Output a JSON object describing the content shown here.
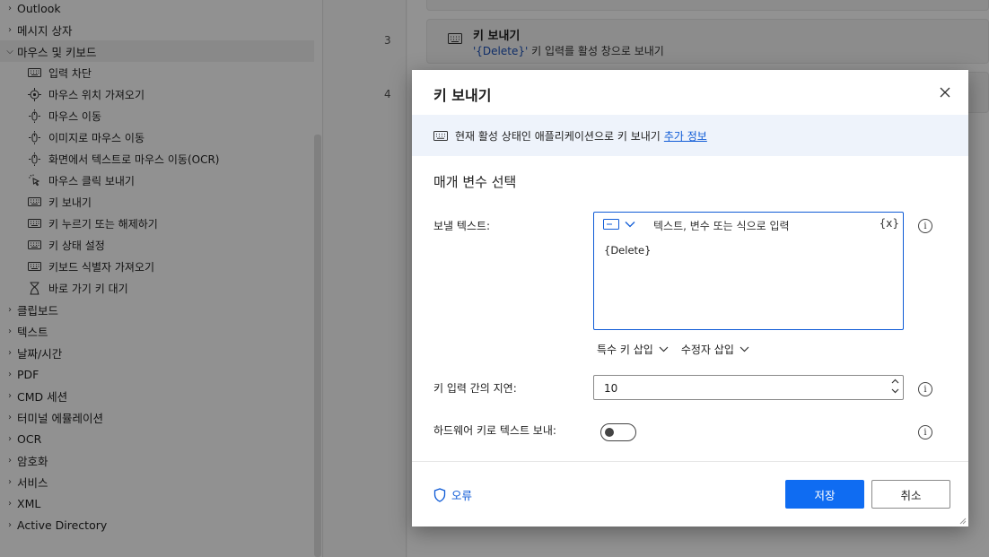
{
  "sidebar": {
    "items_before": [
      {
        "label": "Outlook",
        "expanded": false
      },
      {
        "label": "메시지 상자",
        "expanded": false
      },
      {
        "label": "마우스 및 키보드",
        "expanded": true
      }
    ],
    "sub_items": [
      {
        "label": "입력 차단",
        "icon": "keyboard-icon"
      },
      {
        "label": "마우스 위치 가져오기",
        "icon": "crosshair-icon"
      },
      {
        "label": "마우스 이동",
        "icon": "mouse-move-icon"
      },
      {
        "label": "이미지로 마우스 이동",
        "icon": "mouse-move-icon"
      },
      {
        "label": "화면에서 텍스트로 마우스 이동(OCR)",
        "icon": "mouse-move-icon"
      },
      {
        "label": "마우스 클릭 보내기",
        "icon": "mouse-click-icon"
      },
      {
        "label": "키 보내기",
        "icon": "keyboard-icon"
      },
      {
        "label": "키 누르기 또는 해제하기",
        "icon": "keyboard-icon"
      },
      {
        "label": "키 상태 설정",
        "icon": "keyboard-icon"
      },
      {
        "label": "키보드 식별자 가져오기",
        "icon": "keyboard-icon"
      },
      {
        "label": "바로 가기 키 대기",
        "icon": "hourglass-icon"
      }
    ],
    "items_after": [
      {
        "label": "클립보드"
      },
      {
        "label": "텍스트"
      },
      {
        "label": "날짜/시간"
      },
      {
        "label": "PDF"
      },
      {
        "label": "CMD 세션"
      },
      {
        "label": "터미널 에뮬레이션"
      },
      {
        "label": "OCR"
      },
      {
        "label": "암호화"
      },
      {
        "label": "서비스"
      },
      {
        "label": "XML"
      },
      {
        "label": "Active Directory"
      }
    ]
  },
  "flow": {
    "line_numbers": [
      "3",
      "4"
    ],
    "step3": {
      "title": "키 보내기",
      "var": "'{Delete}'",
      "desc": " 키 입력를 활성 창으로 보내기"
    }
  },
  "dialog": {
    "title": "키 보내기",
    "banner_text": "현재 활성 상태인 애플리케이션으로 키 보내기",
    "banner_link": "추가 정보",
    "section_title": "매개 변수 선택",
    "send_text_label": "보낼 텍스트:",
    "send_text_placeholder": "텍스트, 변수 또는 식으로 입력",
    "send_text_var_button": "{x}",
    "send_text_value": "{Delete}",
    "insert_special_key": "특수 키 삽입",
    "insert_modifier": "수정자 삽입",
    "delay_label": "키 입력 간의 지연:",
    "delay_value": "10",
    "hardware_label": "하드웨어 키로 텍스트 보내:",
    "hardware_on": false,
    "error_label": "오류",
    "save_label": "저장",
    "cancel_label": "취소"
  },
  "colors": {
    "accent": "#0f6cf2",
    "link": "#0f5bd6",
    "banner_bg": "#eef3fb"
  }
}
